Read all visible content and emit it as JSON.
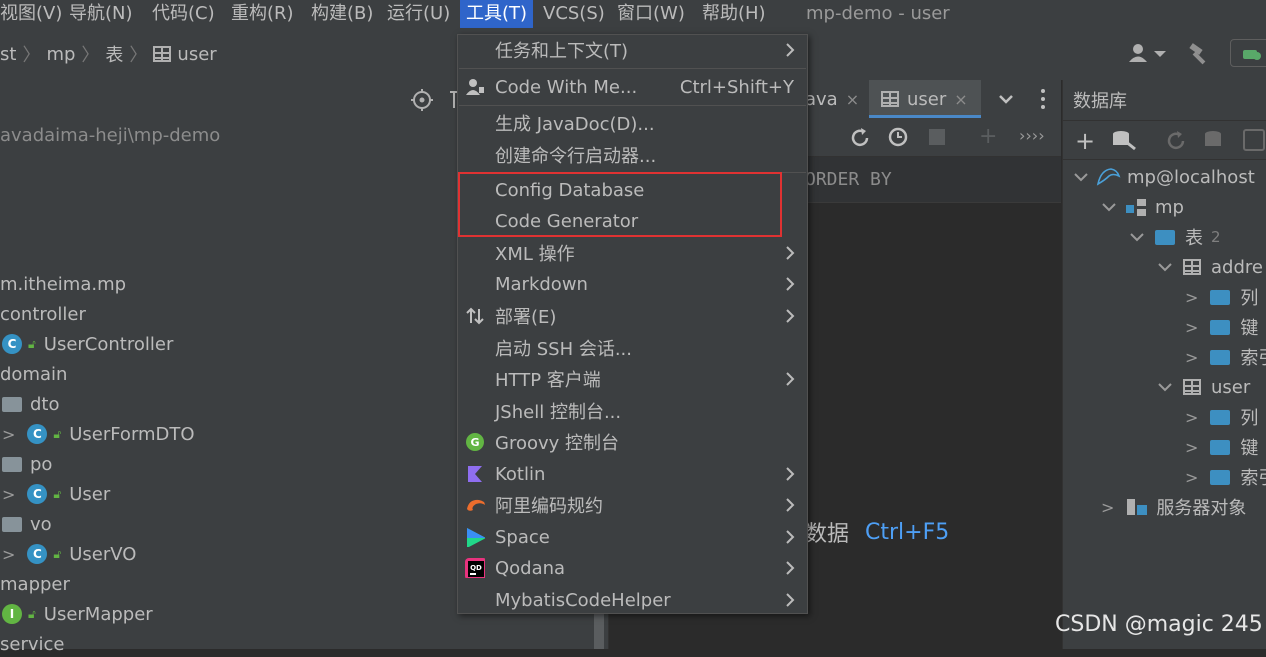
{
  "menubar": {
    "items": [
      "视图(V)",
      "导航(N)",
      "代码(C)",
      "重构(R)",
      "构建(B)",
      "运行(U)",
      "工具(T)",
      "VCS(S)",
      "窗口(W)",
      "帮助(H)"
    ],
    "active_index": 6,
    "window_title": "mp-demo - user"
  },
  "breadcrumb": [
    "st",
    "mp",
    "表",
    "user"
  ],
  "project": {
    "path": "avadaima-heji\\mp-demo",
    "items": [
      {
        "label": "m.itheima.mp"
      },
      {
        "label": "controller"
      },
      {
        "label": "UserController",
        "badge": "C"
      },
      {
        "label": "domain"
      },
      {
        "label": "dto"
      },
      {
        "label": "UserFormDTO",
        "badge": "C"
      },
      {
        "label": "po"
      },
      {
        "label": "User",
        "badge": "C"
      },
      {
        "label": "vo"
      },
      {
        "label": "UserVO",
        "badge": "C"
      },
      {
        "label": "mapper"
      },
      {
        "label": "UserMapper",
        "badge": "I"
      },
      {
        "label": "service"
      }
    ]
  },
  "editor": {
    "tab_prev": "ava",
    "tab_active": "user",
    "sql_fragment": "ORDER BY",
    "hint_text": "数据",
    "hint_shortcut": "Ctrl+F5"
  },
  "database": {
    "title": "数据库",
    "tree": [
      {
        "label": "mp@localhost"
      },
      {
        "label": "mp"
      },
      {
        "label": "表",
        "count": "2"
      },
      {
        "label": "addre"
      },
      {
        "label": "列"
      },
      {
        "label": "键"
      },
      {
        "label": "索引"
      },
      {
        "label": "user"
      },
      {
        "label": "列"
      },
      {
        "label": "键"
      },
      {
        "label": "索引"
      },
      {
        "label": "服务器对象"
      }
    ]
  },
  "tools_menu": {
    "items": [
      {
        "label": "任务和上下文(T)",
        "submenu": true
      },
      {
        "label": "Code With Me...",
        "shortcut": "Ctrl+Shift+Y"
      },
      {
        "label": "生成 JavaDoc(D)..."
      },
      {
        "label": "创建命令行启动器..."
      },
      {
        "label": "Config Database"
      },
      {
        "label": "Code Generator"
      },
      {
        "label": "XML 操作",
        "submenu": true
      },
      {
        "label": "Markdown",
        "submenu": true
      },
      {
        "label": "部署(E)",
        "submenu": true
      },
      {
        "label": "启动 SSH 会话..."
      },
      {
        "label": "HTTP 客户端",
        "submenu": true
      },
      {
        "label": "JShell 控制台..."
      },
      {
        "label": "Groovy 控制台"
      },
      {
        "label": "Kotlin",
        "submenu": true
      },
      {
        "label": "阿里编码规约",
        "submenu": true
      },
      {
        "label": "Space",
        "submenu": true
      },
      {
        "label": "Qodana",
        "submenu": true
      },
      {
        "label": "MybatisCodeHelper",
        "submenu": true
      }
    ]
  },
  "watermark": "CSDN @magic 245",
  "colors": {
    "menu_active": "#2f65ca",
    "highlight_box": "#e03232",
    "shortcut_blue": "#4e9ff5",
    "class_badge": "#3592c4",
    "interface_badge": "#62b543"
  }
}
